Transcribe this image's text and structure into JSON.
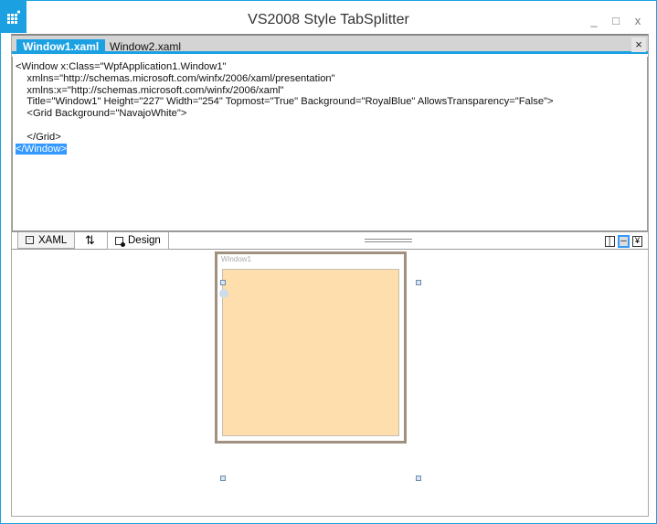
{
  "window": {
    "title": "VS2008 Style TabSplitter",
    "minimize": "_",
    "maximize": "□",
    "close": "x"
  },
  "tabs": [
    {
      "label": "Window1.xaml",
      "active": true
    },
    {
      "label": "Window2.xaml",
      "active": false
    }
  ],
  "tab_close": "×",
  "editor": {
    "lines": [
      "<Window x:Class=\"WpfApplication1.Window1\"",
      "    xmlns=\"http://schemas.microsoft.com/winfx/2006/xaml/presentation\"",
      "    xmlns:x=\"http://schemas.microsoft.com/winfx/2006/xaml\"",
      "    Title=\"Window1\" Height=\"227\" Width=\"254\" Topmost=\"True\" Background=\"RoyalBlue\" AllowsTransparency=\"False\">",
      "    <Grid Background=\"NavajoWhite\">",
      "",
      "    </Grid>"
    ],
    "selected_line": "</Window>"
  },
  "split_tabs": {
    "xaml": "XAML",
    "swap": "⇅",
    "design": "Design"
  },
  "design": {
    "window_title": "Window1",
    "grid_color": "#ffdead"
  }
}
